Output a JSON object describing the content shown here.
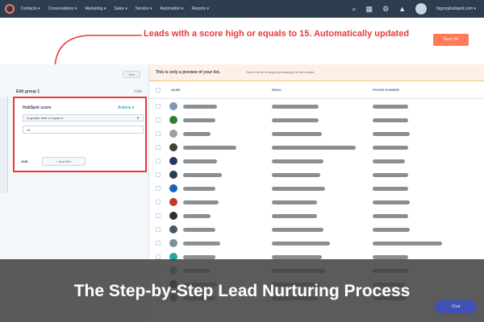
{
  "nav": {
    "items": [
      "Contacts ▾",
      "Conversations ▾",
      "Marketing ▾",
      "Sales ▾",
      "Service ▾",
      "Automation ▾",
      "Reports ▾"
    ],
    "account_name": "bigcorphubspot.com ▾"
  },
  "annotation": "Leads with a score high or equals to 15. Automatically updated",
  "actions": {
    "save_label": "Save list",
    "test_label": "Test"
  },
  "filter_panel": {
    "group_title": "Edit group 1",
    "hide_label": "Hide",
    "property_label": "HubSpot score",
    "actions_label": "Actions ▾",
    "operator": "is greater than or equal to",
    "value": "15",
    "and_label": "AND",
    "add_filter_label": "+ Add filter"
  },
  "preview": {
    "title": "This is only a preview of your list.",
    "hint": "Save this list to begin processing the full results."
  },
  "table": {
    "columns": [
      "NAME",
      "EMAIL",
      "PHONE NUMBER"
    ]
  },
  "caption": "The Step-by-Step Lead Nurturing Process",
  "chat_label": "Chat",
  "colors": {
    "nav_bg": "#2d3e50",
    "accent": "#ff7a59",
    "highlight": "#e8383d",
    "caption_bg": "#404040"
  }
}
